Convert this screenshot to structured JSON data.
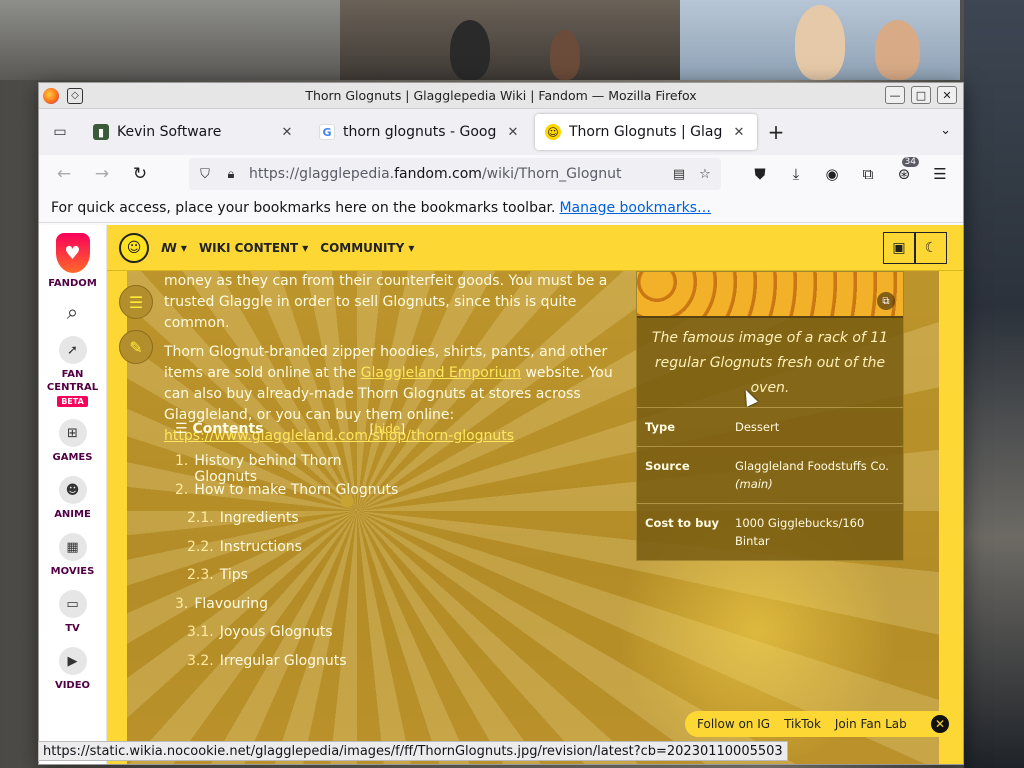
{
  "window": {
    "title": "Thorn Glognuts | Glagglepedia Wiki | Fandom — Mozilla Firefox"
  },
  "tabs": [
    {
      "label": "Kevin Software",
      "active": false
    },
    {
      "label": "thorn glognuts - Google S",
      "active": false
    },
    {
      "label": "Thorn Glognuts | Glaggle",
      "active": true
    }
  ],
  "navbar": {
    "url_prefix": "https://glagglepedia.",
    "url_domain": "fandom.com",
    "url_path": "/wiki/Thorn_Glognut",
    "extensions_badge": "34"
  },
  "bookmarks": {
    "message": "For quick access, place your bookmarks here on the bookmarks toolbar.",
    "manage_link": "Manage bookmarks…"
  },
  "rail": {
    "logo_label": "FANDOM",
    "items": [
      {
        "label": "FAN CENTRAL",
        "badge": "BETA",
        "icon": "rocket-icon"
      },
      {
        "label": "GAMES",
        "icon": "gamepad-icon"
      },
      {
        "label": "ANIME",
        "icon": "anime-icon"
      },
      {
        "label": "MOVIES",
        "icon": "movie-icon"
      },
      {
        "label": "TV",
        "icon": "tv-icon"
      },
      {
        "label": "VIDEO",
        "icon": "video-icon"
      }
    ]
  },
  "wiki_header": {
    "nav1": "WIKI CONTENT",
    "nav2": "COMMUNITY"
  },
  "article": {
    "para1_text": "money as they can from their counterfeit goods. You must be a trusted Glaggle in order to sell Glognuts, since this is quite common.",
    "para2_a": "Thorn Glognut-branded zipper hoodies, shirts, pants, and other items are sold online at the ",
    "para2_link": "Glaggleland Emporium",
    "para2_b": " website. You can also buy already-made Thorn Glognuts at stores across Glaggleland, or you can buy them online: ",
    "para2_url": "https://www.glaggleland.com/shop/thorn-glognuts"
  },
  "toc": {
    "title": "Contents",
    "hide_label": "hide",
    "items": [
      {
        "num": "1.",
        "label": "History behind Thorn Glognuts",
        "sub": false
      },
      {
        "num": "2.",
        "label": "How to make Thorn Glognuts",
        "sub": false
      },
      {
        "num": "2.1.",
        "label": "Ingredients",
        "sub": true
      },
      {
        "num": "2.2.",
        "label": "Instructions",
        "sub": true
      },
      {
        "num": "2.3.",
        "label": "Tips",
        "sub": true
      },
      {
        "num": "3.",
        "label": "Flavouring",
        "sub": false
      },
      {
        "num": "3.1.",
        "label": "Joyous Glognuts",
        "sub": true
      },
      {
        "num": "3.2.",
        "label": "Irregular Glognuts",
        "sub": true
      }
    ]
  },
  "infobox": {
    "caption": "The famous image of a rack of 11 regular Glognuts fresh out of the oven.",
    "rows": [
      {
        "key": "Type",
        "value": "Dessert",
        "note": ""
      },
      {
        "key": "Source",
        "value": "Glaggleland Foodstuffs Co.",
        "note": "(main)"
      },
      {
        "key": "Cost to buy",
        "value": "1000 Gigglebucks/160 Bintar",
        "note": ""
      }
    ]
  },
  "fanlab": {
    "ig": "Follow on IG",
    "tiktok": "TikTok",
    "join": "Join Fan Lab"
  },
  "statusbar": {
    "url": "https://static.wikia.nocookie.net/glagglepedia/images/f/ff/ThornGlognuts.jpg/revision/latest?cb=20230110005503"
  }
}
